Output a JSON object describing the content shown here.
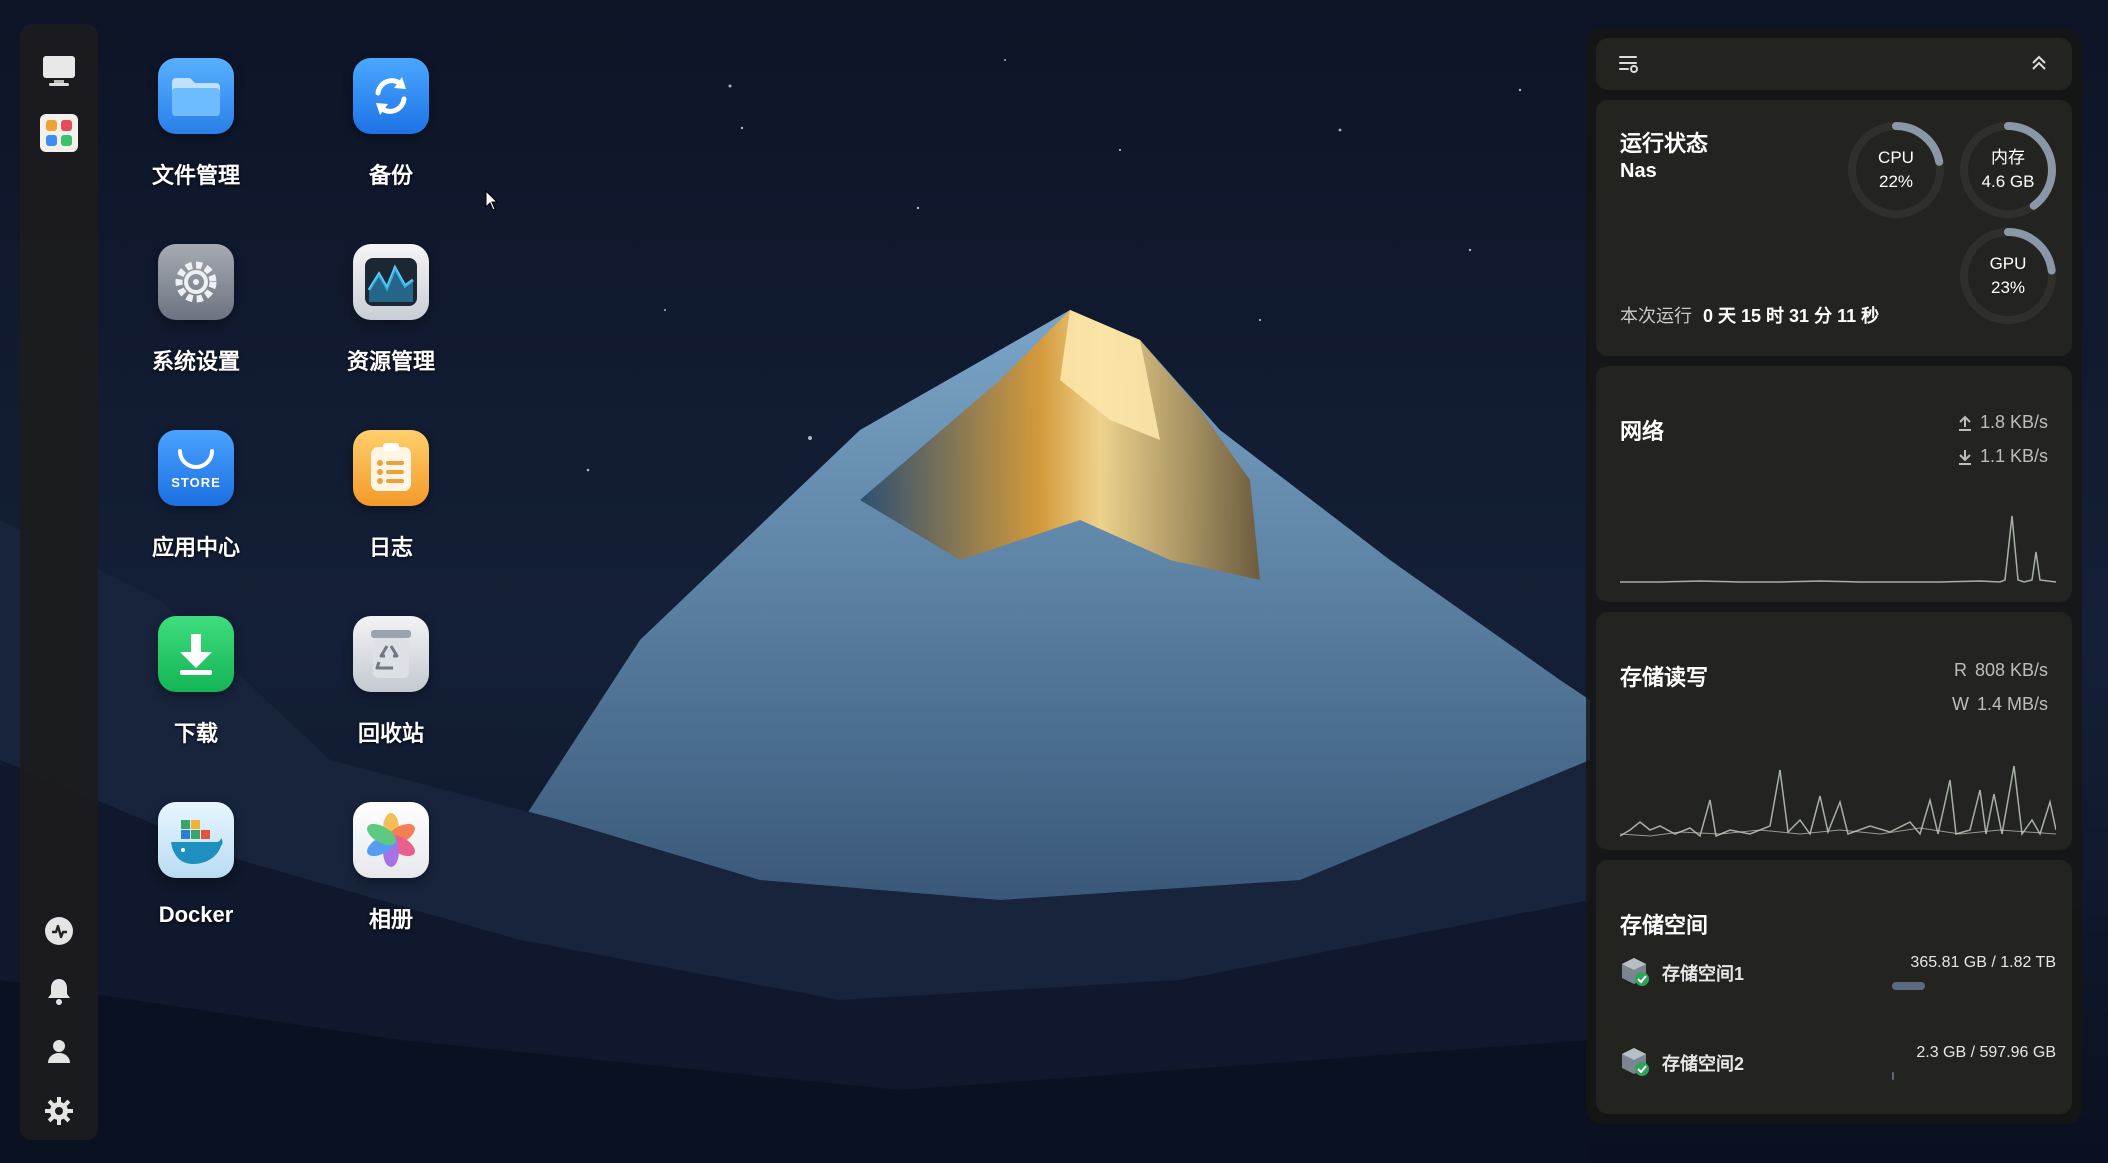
{
  "desktop": {
    "apps": [
      {
        "label": "文件管理",
        "icon": "folder-icon"
      },
      {
        "label": "备份",
        "icon": "backup-sync-icon"
      },
      {
        "label": "系统设置",
        "icon": "settings-gear-icon"
      },
      {
        "label": "资源管理",
        "icon": "activity-monitor-icon"
      },
      {
        "label": "应用中心",
        "icon": "store-bag-icon",
        "badge": "STORE"
      },
      {
        "label": "日志",
        "icon": "log-list-icon"
      },
      {
        "label": "下载",
        "icon": "download-icon"
      },
      {
        "label": "回收站",
        "icon": "recycle-bin-icon"
      },
      {
        "label": "Docker",
        "icon": "docker-whale-icon"
      },
      {
        "label": "相册",
        "icon": "photos-flower-icon"
      }
    ]
  },
  "dock": {
    "top_items": [
      "desktop-icon",
      "app-launcher-icon"
    ],
    "bottom_items": [
      "status-icon",
      "bell-icon",
      "user-icon",
      "gear-icon"
    ]
  },
  "panel": {
    "status": {
      "title": "运行状态",
      "host": "Nas",
      "uptime_label": "本次运行",
      "uptime_value": "0 天 15 时 31 分 11 秒",
      "cpu": {
        "label": "CPU",
        "value": "22%",
        "fraction": 0.22
      },
      "memory": {
        "label": "内存",
        "value": "4.6 GB",
        "fraction": 0.4
      },
      "gpu": {
        "label": "GPU",
        "value": "23%",
        "fraction": 0.23
      }
    },
    "network": {
      "title": "网络",
      "upload": "1.8 KB/s",
      "download": "1.1 KB/s"
    },
    "disk_io": {
      "title": "存储读写",
      "read_label": "R",
      "read": "808 KB/s",
      "write_label": "W",
      "write": "1.4 MB/s"
    },
    "storage": {
      "title": "存储空间",
      "volumes": [
        {
          "name": "存储空间1",
          "size": "365.81 GB / 1.82 TB",
          "fraction": 0.2
        },
        {
          "name": "存储空间2",
          "size": "2.3 GB / 597.96 GB",
          "fraction": 0.004
        }
      ]
    }
  },
  "colors": {
    "accent_blue": "#3d8cf0",
    "download_green": "#2fcb6a",
    "gauge_arc": "#8a97a6",
    "graph_line": "#a8b0a6",
    "panel_bg": "#1c1c18"
  }
}
